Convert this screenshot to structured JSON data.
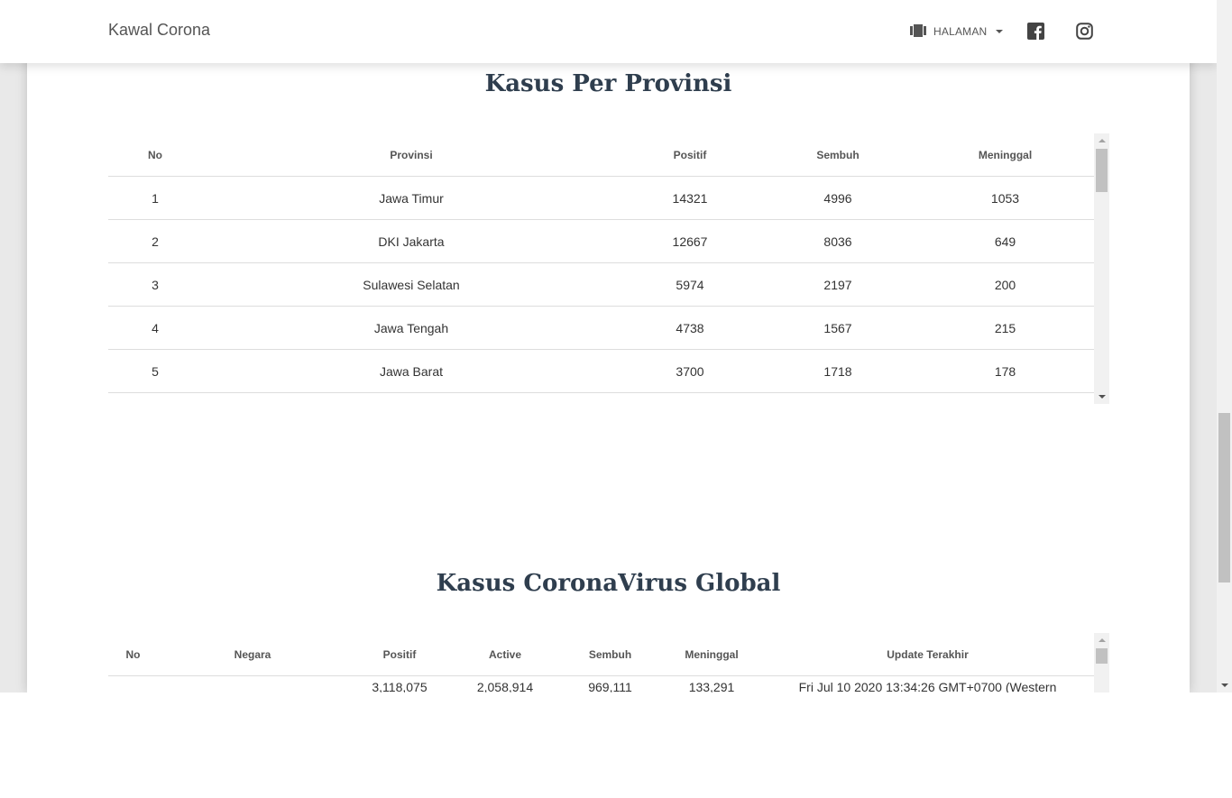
{
  "navbar": {
    "brand": "Kawal Corona",
    "menu_label": "HALAMAN",
    "menu_icon": "view-carousel-icon",
    "social": [
      "facebook-icon",
      "instagram-icon"
    ]
  },
  "provinsi": {
    "title": "Kasus Per Provinsi",
    "columns": [
      "No",
      "Provinsi",
      "Positif",
      "Sembuh",
      "Meninggal"
    ],
    "rows": [
      [
        "1",
        "Jawa Timur",
        "14321",
        "4996",
        "1053"
      ],
      [
        "2",
        "DKI Jakarta",
        "12667",
        "8036",
        "649"
      ],
      [
        "3",
        "Sulawesi Selatan",
        "5974",
        "2197",
        "200"
      ],
      [
        "4",
        "Jawa Tengah",
        "4738",
        "1567",
        "215"
      ],
      [
        "5",
        "Jawa Barat",
        "3700",
        "1718",
        "178"
      ]
    ]
  },
  "global": {
    "title": "Kasus CoronaVirus Global",
    "columns": [
      "No",
      "Negara",
      "Positif",
      "Active",
      "Sembuh",
      "Meninggal",
      "Update Terakhir"
    ],
    "rows": [
      [
        "",
        "",
        "3,118,075",
        "2,058,914",
        "969,111",
        "133,291",
        "Fri Jul 10 2020 13:34:26 GMT+0700 (Western"
      ]
    ]
  },
  "colors": {
    "title": "#2f3e4e",
    "border": "#dddddd",
    "background": "#ffffff"
  }
}
